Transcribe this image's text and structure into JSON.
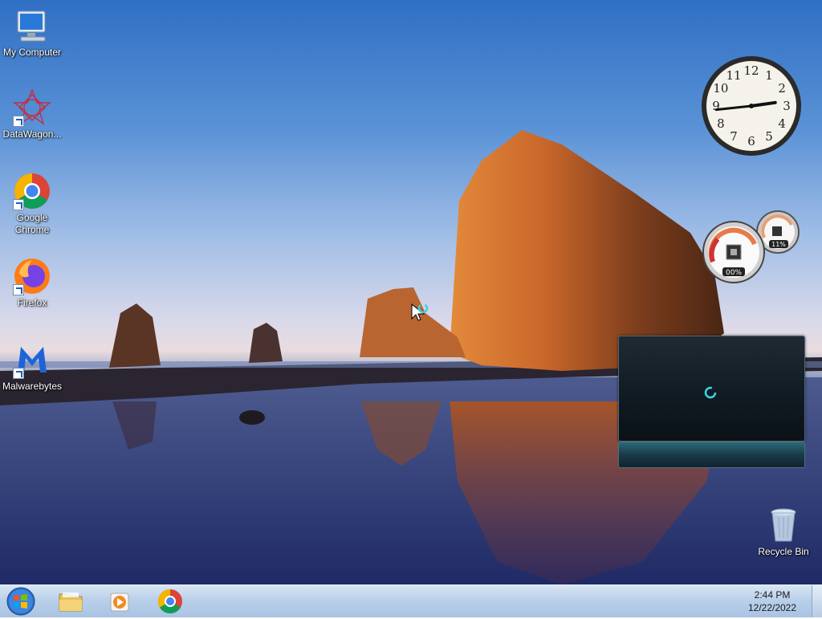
{
  "desktop": {
    "icons": [
      {
        "label": "My Computer",
        "icon": "computer-icon"
      },
      {
        "label": "DataWagon...",
        "icon": "datawagon-icon"
      },
      {
        "label": "Google Chrome",
        "icon": "chrome-icon"
      },
      {
        "label": "Firefox",
        "icon": "firefox-icon"
      },
      {
        "label": "Malwarebytes",
        "icon": "malwarebytes-icon"
      },
      {
        "label": "Recycle Bin",
        "icon": "recycle-bin-icon"
      }
    ]
  },
  "gadgets": {
    "clock": {
      "numbers": [
        "12",
        "1",
        "2",
        "3",
        "4",
        "5",
        "6",
        "7",
        "8",
        "9",
        "10",
        "11"
      ],
      "hour": 2,
      "minute": 44
    },
    "cpu_meter": {
      "cpu_percent_label": "00%",
      "memory_percent_label": "11%",
      "cpu_percent": 0,
      "memory_percent": 11
    },
    "media": {
      "state": "loading"
    }
  },
  "taskbar": {
    "start": "start-button",
    "pinned": [
      {
        "name": "windows-explorer",
        "icon": "folder-icon"
      },
      {
        "name": "media-player",
        "icon": "media-player-icon"
      },
      {
        "name": "chrome",
        "icon": "chrome-icon"
      }
    ],
    "time": "2:44 PM",
    "date": "12/22/2022"
  },
  "colors": {
    "taskbar": "#b9d0ea",
    "accent_cyan": "#38d7e0"
  }
}
